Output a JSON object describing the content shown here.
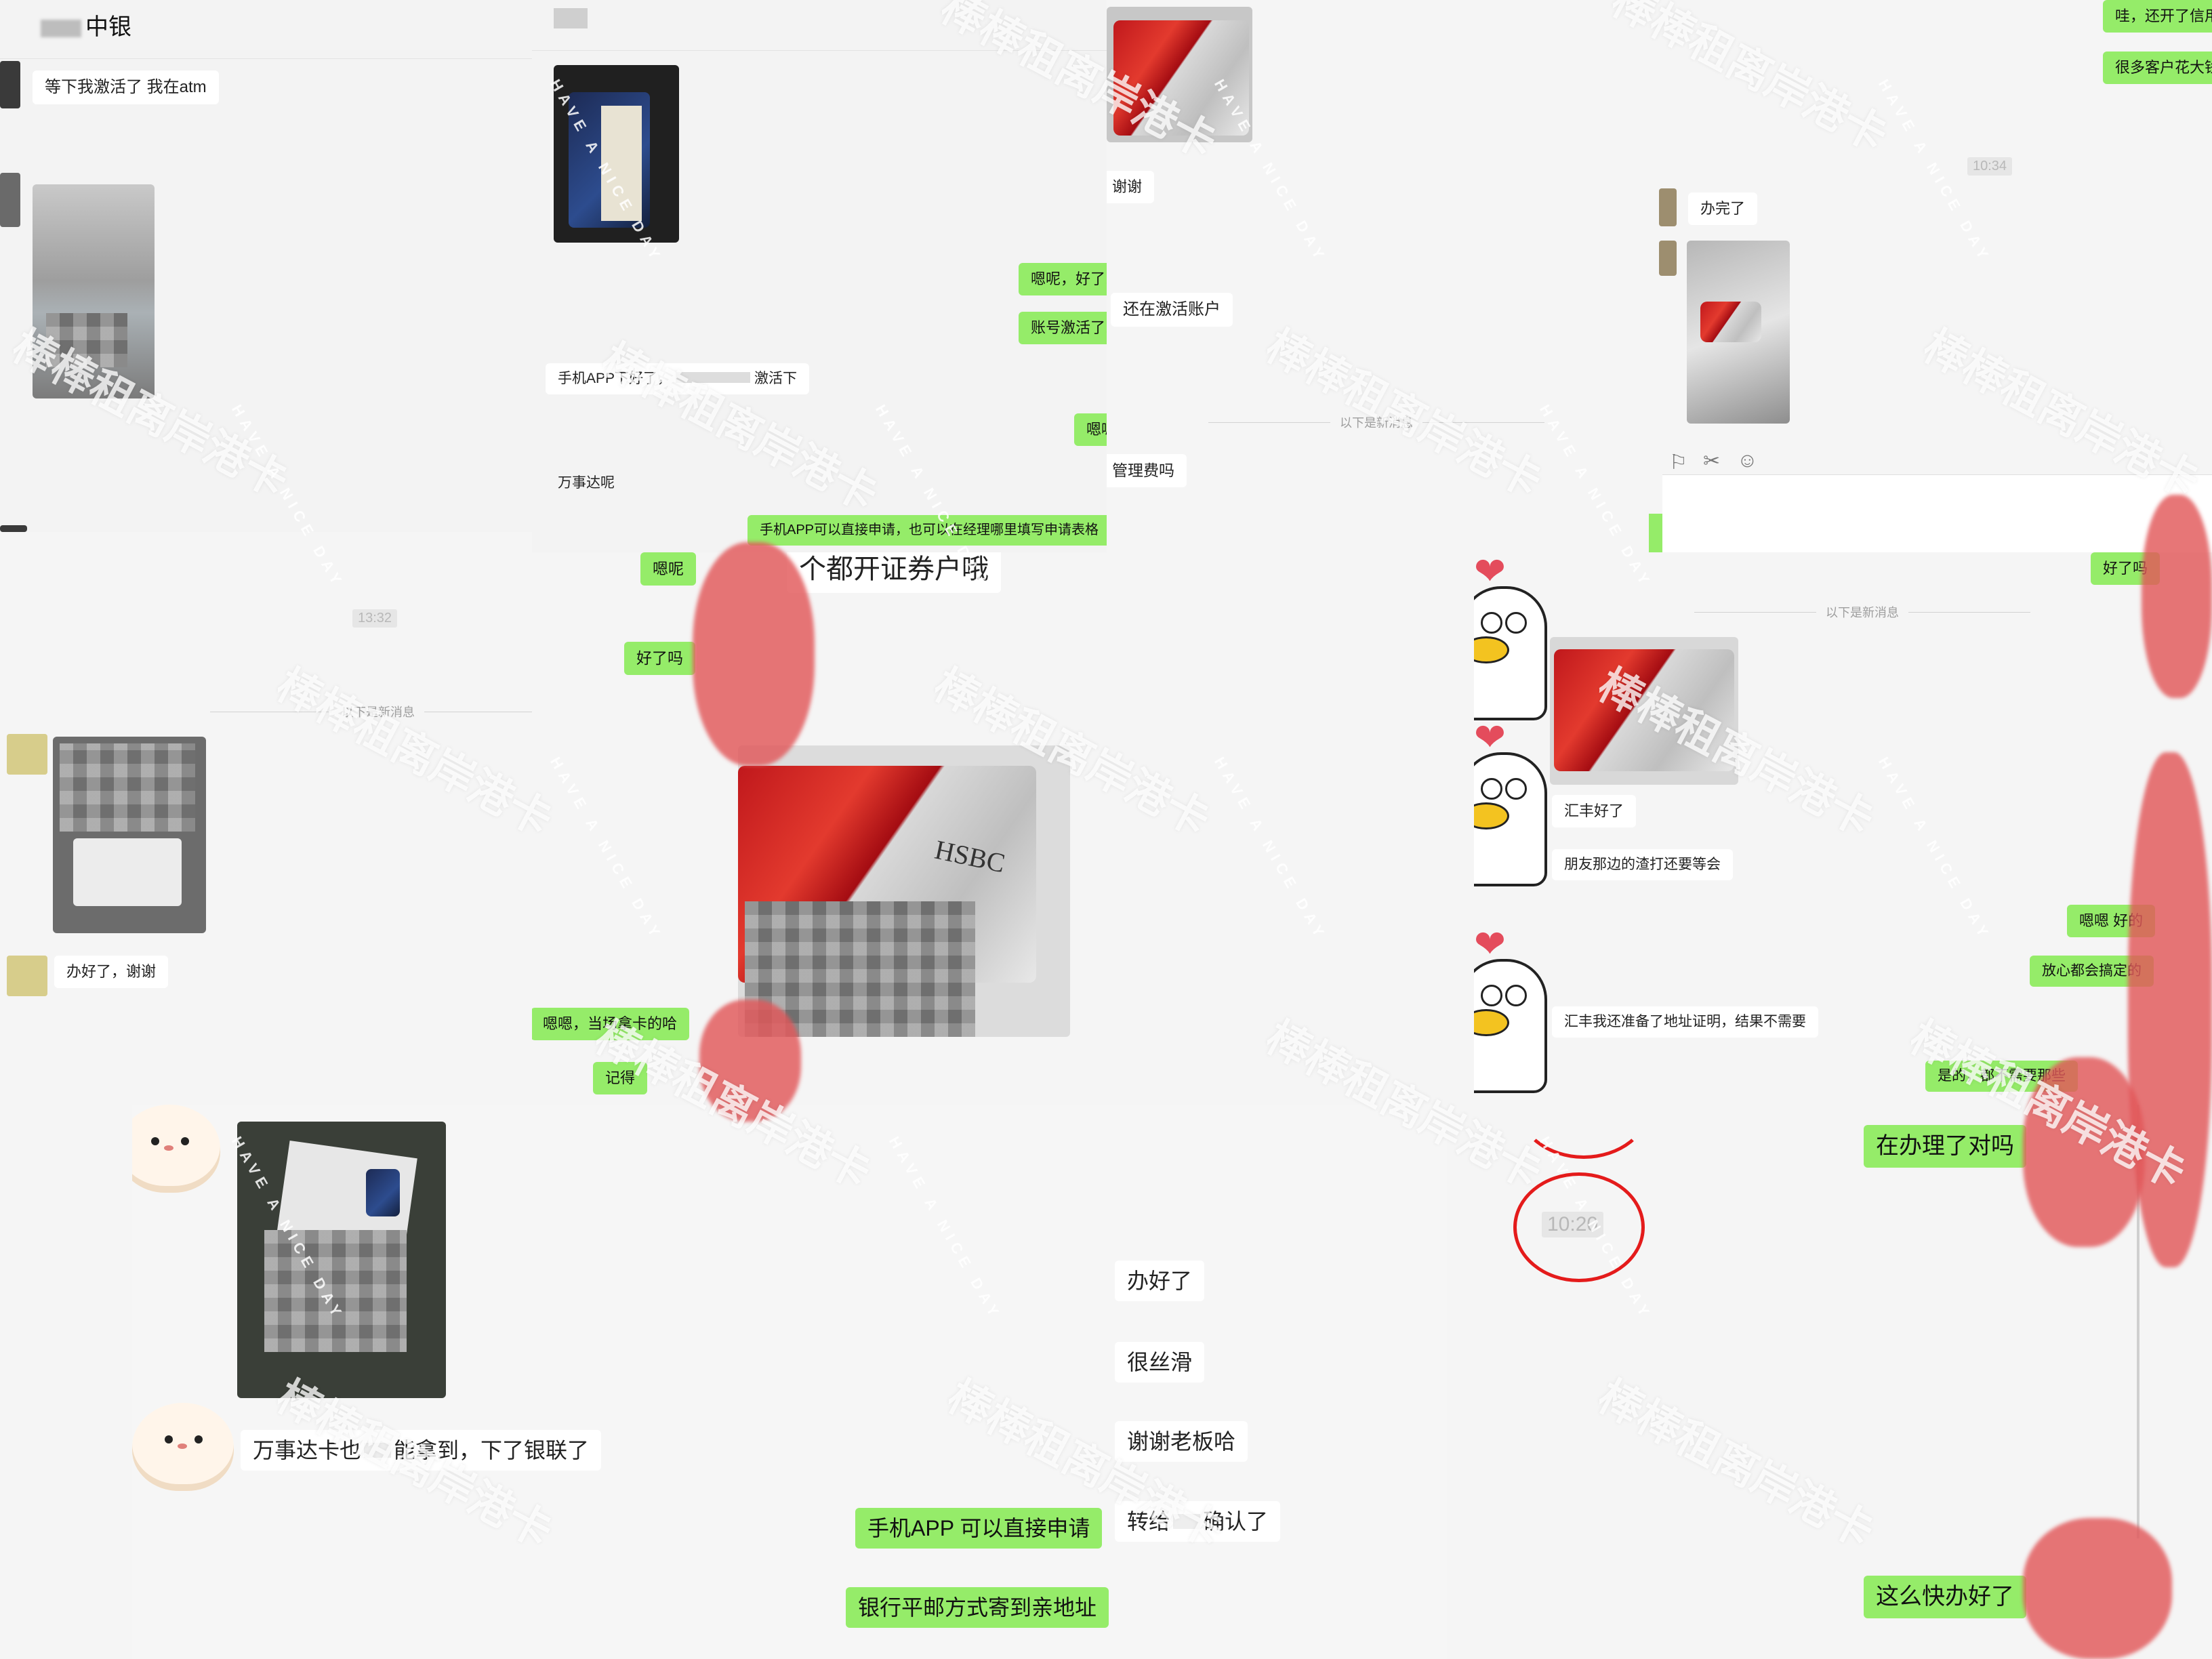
{
  "panels": {
    "p1": {
      "contact_name": "中银",
      "msg_1": "等下我激活了 我在atm",
      "time": "13:32",
      "divider": "以下是新消息",
      "msg_2": "办好了，谢谢"
    },
    "p2": {
      "msg_out_1": "嗯呢，好了!",
      "msg_out_2": "账号激活了!",
      "msg_in_1": "手机APP下好了，",
      "msg_in_1b": "激活下",
      "msg_out_3": "嗯嗯",
      "msg_in_2": "万事达呢",
      "msg_out_4": "手机APP可以直接申请，也可以在经理哪里填写申请表格",
      "msg_out_5": "嗯呢",
      "msg_in_3": "个都开证券户哦",
      "msg_out_6": "好了吗",
      "msg_out_7": "嗯嗯，当场拿卡的哈",
      "msg_out_8": "记得"
    },
    "p3": {
      "msg_in_1": "谢谢",
      "msg_in_2": "还在激活账户",
      "divider": "以下是新消息",
      "msg_in_3": "管理费吗"
    },
    "p4": {
      "msg_out_1": "哇，还开了信用",
      "msg_out_2": "很多客户花大钱",
      "time": "10:34",
      "msg_in_1": "办完了"
    },
    "p5": {
      "divider": "以下是新消息",
      "msg_out_1": "好了吗",
      "msg_in_1": "汇丰好了",
      "msg_in_2": "朋友那边的渣打还要等会",
      "msg_in_3": "汇丰我还准备了地址证明，结果不需要",
      "msg_out_2": "嗯嗯 好的",
      "msg_out_3": "放心都会搞定的",
      "msg_out_4": "是的，都不需要那些",
      "msg_out_5": "在办理了对吗",
      "time": "10:20",
      "msg_out_6": "这么快办好了"
    },
    "p6": {
      "msg_in_1": "万事达卡也",
      "msg_in_1b": "能拿到，下了银联了"
    },
    "p7": {
      "msg_in_1": "办好了",
      "msg_in_2": "很丝滑",
      "msg_in_3": "谢谢老板哈",
      "msg_in_4": "转给",
      "msg_in_4b": "确认了",
      "msg_out_1": "手机APP  可以直接申请",
      "msg_out_2": "银行平邮方式寄到亲地址"
    }
  },
  "card_brand": "HSBC",
  "watermark": {
    "main": "棒棒租离岸港卡",
    "small": "HAVE A NICE DAY"
  },
  "icons": [
    "folder-icon",
    "scissors-icon",
    "chat-icon",
    "heart-icon"
  ],
  "colors": {
    "outgoing": "#95ec69",
    "incoming": "#ffffff",
    "redact": "#e2585a",
    "circle": "#e41b1b"
  }
}
